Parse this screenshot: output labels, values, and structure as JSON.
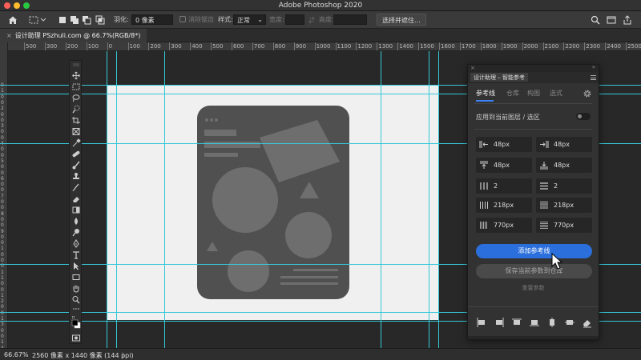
{
  "window": {
    "title": "Adobe Photoshop 2020"
  },
  "options_bar": {
    "feather_label": "羽化:",
    "feather_value": "0 像素",
    "antialias_label": "消除锯齿",
    "style_label": "样式:",
    "style_value": "正常",
    "width_label": "宽度:",
    "height_label": "高度:",
    "select_mask_button": "选择并遮住..."
  },
  "document": {
    "tab_title": "设计助理 PSzhuli.com @ 66.7%(RGB/8*)",
    "close_glyph": "×"
  },
  "ruler": {
    "top_labels": [
      "500",
      "300",
      "200",
      "100",
      "0",
      "100",
      "200",
      "300",
      "400",
      "500",
      "600",
      "700",
      "800",
      "900",
      "1000",
      "1100",
      "1200",
      "1300",
      "1400",
      "1500",
      "1600",
      "1700",
      "1800",
      "1900",
      "2000",
      "2100",
      "2200",
      "2300",
      "2400",
      "2500",
      "2600",
      "2700"
    ],
    "left_labels": [
      "0",
      "1",
      "0",
      "0",
      "2",
      "0",
      "0",
      "3",
      "0",
      "0",
      "4",
      "0",
      "0",
      "5",
      "0",
      "0",
      "6",
      "0",
      "0",
      "7",
      "0",
      "0",
      "8",
      "0",
      "0",
      "9",
      "0",
      "0",
      "1",
      "0",
      "0",
      "0",
      "1",
      "1",
      "0",
      "0",
      "1",
      "2",
      "0",
      "0",
      "1",
      "3",
      "0",
      "0",
      "1",
      "4",
      "0",
      "0"
    ]
  },
  "panel": {
    "title": "设计助理 – 智能参考",
    "tabs": [
      {
        "label": "参考线",
        "active": true
      },
      {
        "label": "仓库",
        "active": false
      },
      {
        "label": "构图",
        "active": false
      },
      {
        "label": "选式",
        "active": false
      }
    ],
    "apply_label": "应用到当前图层 / 选区",
    "apply_toggle_on": false,
    "cells": [
      {
        "icon": "margin-left-icon",
        "value": "48px"
      },
      {
        "icon": "margin-right-icon",
        "value": "48px"
      },
      {
        "icon": "margin-top-icon",
        "value": "48px"
      },
      {
        "icon": "margin-bottom-icon",
        "value": "48px"
      },
      {
        "icon": "columns-icon",
        "value": "2"
      },
      {
        "icon": "rows-icon",
        "value": "2"
      },
      {
        "icon": "column-width-icon",
        "value": "218px"
      },
      {
        "icon": "row-height-icon",
        "value": "218px"
      },
      {
        "icon": "column-gutter-icon",
        "value": "770px"
      },
      {
        "icon": "row-gutter-icon",
        "value": "770px"
      }
    ],
    "add_guides_button": "添加参考线",
    "save_params_button": "保存当前参数到仓库",
    "reset_params_link": "重置参数",
    "accent_color": "#2a6fdb"
  },
  "status": {
    "zoom": "66.67%",
    "info": "2560 像素 x 1440 像素 (144 ppi)",
    "arrow": "〉"
  }
}
